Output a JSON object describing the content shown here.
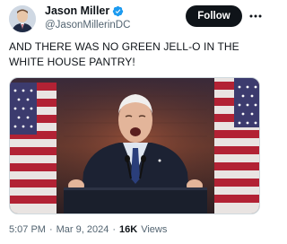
{
  "author": {
    "display_name": "Jason Miller",
    "handle": "@JasonMillerinDC",
    "verified": true,
    "verified_color": "#1d9bf0"
  },
  "actions": {
    "follow_label": "Follow",
    "more_icon": "more-horizontal-icon"
  },
  "tweet": {
    "text": "AND THERE WAS NO GREEN JELL-O IN THE WHITE HOUSE PANTRY!"
  },
  "media": {
    "type": "photo"
  },
  "meta": {
    "time": "5:07 PM",
    "separator": "·",
    "date": "Mar 9, 2024",
    "views_count": "16K",
    "views_label": "Views"
  },
  "colors": {
    "text_primary": "#0f1419",
    "text_secondary": "#536471",
    "button_bg": "#0f1419"
  }
}
